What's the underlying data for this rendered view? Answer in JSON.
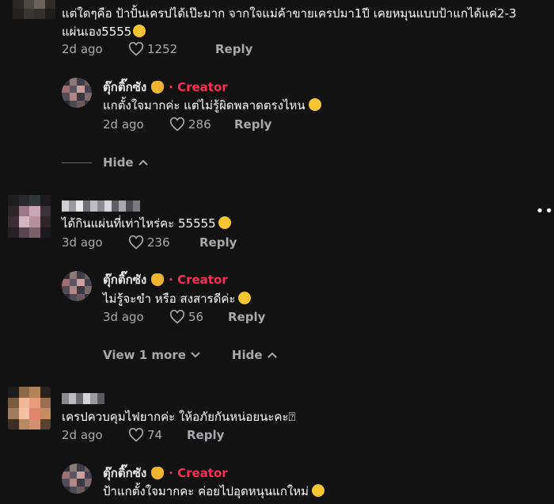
{
  "colors": {
    "background": "#121212",
    "creator_badge": "#fe2c55",
    "muted": "#a9a9ad"
  },
  "comments": [
    {
      "text_line1": "แต่ใดๆคือ ป้าปั้นเครปได้เป๊ะมาก จากใจแม่ค้าขายเครปมา1ปี เคยหมุนแบบป้าแกได้แค่2-3",
      "text_line2": "แผ่นเอง5555",
      "emoji": "smiling-face-with-hearts",
      "date": "2d ago",
      "likes": "1252",
      "reply": "Reply",
      "creator_reply": {
        "name": "ตุ๊กติ๊กซัง",
        "badge": "· Creator",
        "text": "แกตั้งใจมากค่ะ แต่ไม่รู้ผิดพลาดตรงไหน",
        "date": "2d ago",
        "likes": "286",
        "reply": "Reply"
      },
      "hide_label": "Hide"
    },
    {
      "text": "ได้กินแผ่นที่เท่าไหร่คะ 55555",
      "date": "3d ago",
      "likes": "236",
      "reply": "Reply",
      "creator_reply": {
        "name": "ตุ๊กติ๊กซัง",
        "badge": "· Creator",
        "text": "ไม่รู้จะขำ หรือ สงสารดีค่ะ",
        "date": "3d ago",
        "likes": "56",
        "reply": "Reply"
      },
      "view_more_label": "View 1 more",
      "hide_label": "Hide"
    },
    {
      "text": "เครปควบคุมไฟยากค่ะ ให้อภัยกันหน่อยนะคะ",
      "trailing_glyph": "⍰",
      "date": "2d ago",
      "likes": "74",
      "reply": "Reply",
      "creator_reply": {
        "name": "ตุ๊กติ๊กซัง",
        "badge": "· Creator",
        "text": "ป้าแกตั้งใจมากคะ ค่อยไปอุดหนุนแกใหม่"
      }
    }
  ],
  "more_dots": "••"
}
